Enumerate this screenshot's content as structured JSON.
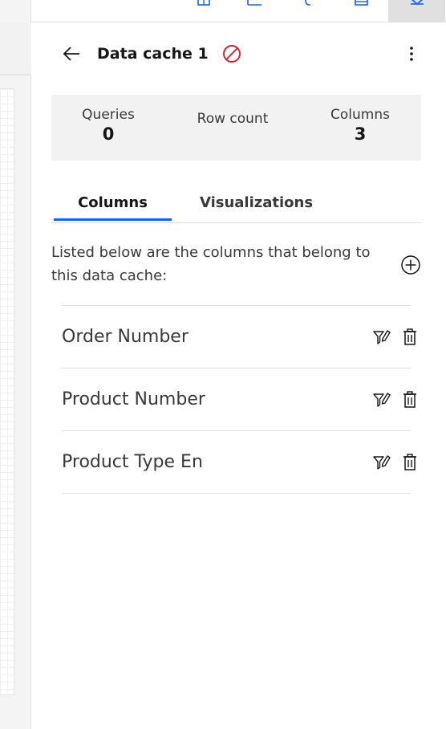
{
  "toolbar": {
    "icons": [
      "data-source-icon",
      "chart-icon",
      "link-icon",
      "table-icon",
      "data-cache-icon"
    ],
    "active_index": 4,
    "accent": "#0f62fe"
  },
  "panel": {
    "title": "Data cache 1",
    "status_icon": "disabled-icon",
    "status_color": "#da1e28",
    "stats": {
      "queries": {
        "label": "Queries",
        "value": "0"
      },
      "row_count": {
        "label": "Row count",
        "value": ""
      },
      "columns": {
        "label": "Columns",
        "value": "3"
      }
    },
    "tabs": [
      {
        "label": "Columns",
        "active": true
      },
      {
        "label": "Visualizations",
        "active": false
      }
    ],
    "description": "Listed below are the columns that belong to this data cache:",
    "columns": [
      {
        "name": "Order Number"
      },
      {
        "name": "Product Number"
      },
      {
        "name": "Product Type En"
      }
    ]
  }
}
